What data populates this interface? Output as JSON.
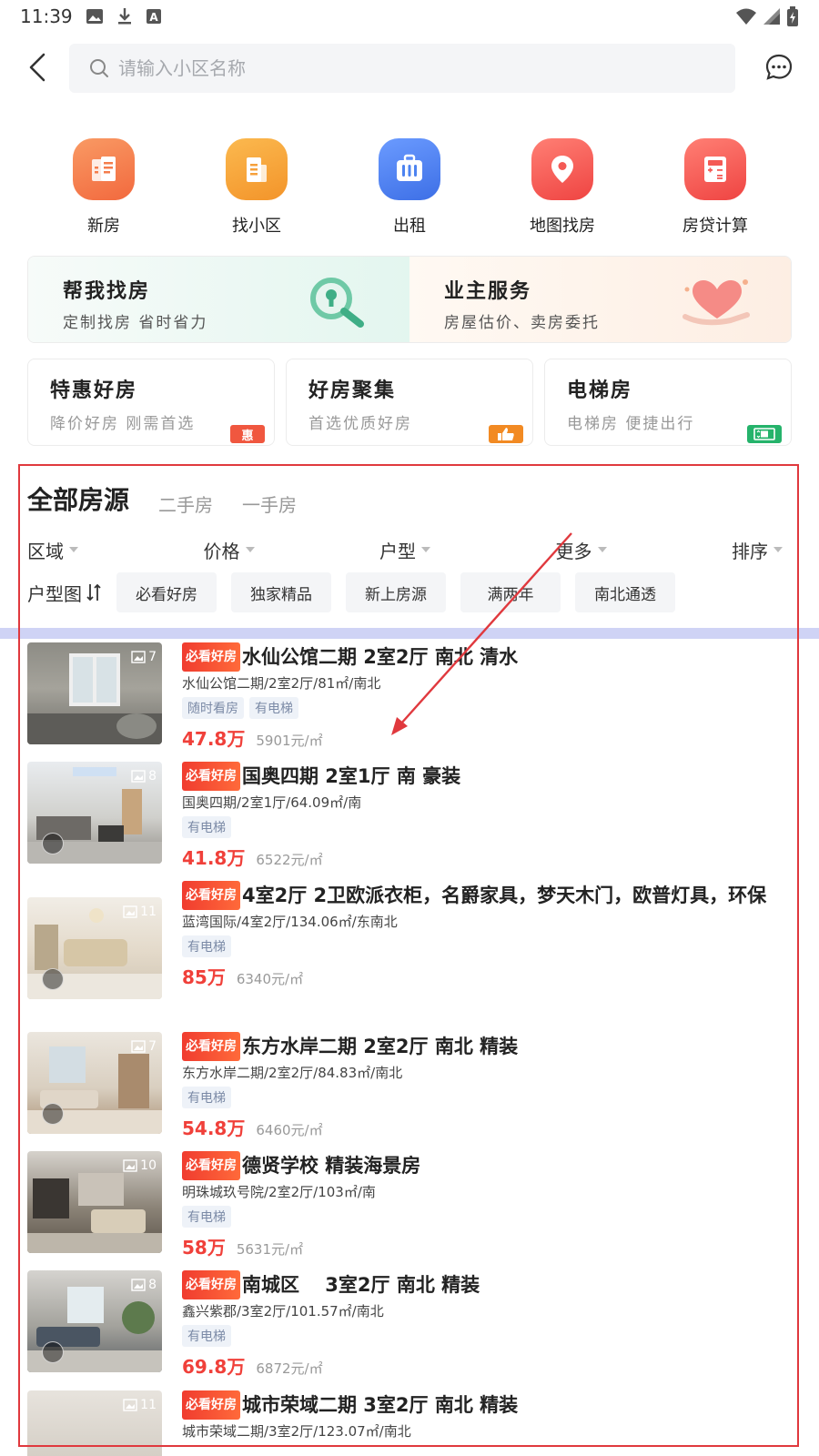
{
  "status_bar": {
    "time": "11:39"
  },
  "search": {
    "placeholder": "请输入小区名称"
  },
  "quick_nav": [
    {
      "label": "新房",
      "icon": "new-house-icon",
      "color": "#f47d4c"
    },
    {
      "label": "找小区",
      "icon": "community-icon",
      "color": "#f6a13c"
    },
    {
      "label": "出租",
      "icon": "rent-icon",
      "color": "#4d83f0"
    },
    {
      "label": "地图找房",
      "icon": "map-pin-icon",
      "color": "#f45a55"
    },
    {
      "label": "房贷计算",
      "icon": "calculator-icon",
      "color": "#f45a55"
    }
  ],
  "service_banner": {
    "left": {
      "title": "帮我找房",
      "subtitle": "定制找房 省时省力"
    },
    "right": {
      "title": "业主服务",
      "subtitle": "房屋估价、卖房委托"
    }
  },
  "feature_cards": [
    {
      "title": "特惠好房",
      "subtitle": "降价好房 刚需首选",
      "badge": "惠",
      "badge_color": "#f0573f"
    },
    {
      "title": "好房聚集",
      "subtitle": "首选优质好房",
      "badge": "",
      "badge_color": "#f28a23"
    },
    {
      "title": "电梯房",
      "subtitle": "电梯房 便捷出行",
      "badge": "",
      "badge_color": "#25b36b"
    }
  ],
  "tabs": [
    "全部房源",
    "二手房",
    "一手房"
  ],
  "filters": [
    "区域",
    "价格",
    "户型",
    "更多",
    "排序"
  ],
  "layout_toggle": "户型图",
  "chips": [
    "必看好房",
    "独家精品",
    "新上房源",
    "满两年",
    "南北通透"
  ],
  "badge_text": "必看好房",
  "listings": [
    {
      "title": "水仙公馆二期 2室2厅 南北 清水",
      "summary": "水仙公馆二期/2室2厅/81㎡/南北",
      "tags": [
        "随时看房",
        "有电梯"
      ],
      "price": "47.8万",
      "unit_price": "5901元/㎡",
      "photo_count": "7",
      "has_badge": true,
      "vr": false
    },
    {
      "title": "国奥四期 2室1厅 南 豪装",
      "summary": "国奥四期/2室1厅/64.09㎡/南",
      "tags": [
        "有电梯"
      ],
      "price": "41.8万",
      "unit_price": "6522元/㎡",
      "photo_count": "8",
      "has_badge": true,
      "vr": true
    },
    {
      "title": "4室2厅 2卫欧派衣柜，名爵家具，梦天木门，欧普灯具，环保",
      "summary": "蓝湾国际/4室2厅/134.06㎡/东南北",
      "tags": [
        "有电梯"
      ],
      "price": "85万",
      "unit_price": "6340元/㎡",
      "photo_count": "11",
      "has_badge": true,
      "vr": true
    },
    {
      "title": "东方水岸二期 2室2厅 南北 精装",
      "summary": "东方水岸二期/2室2厅/84.83㎡/南北",
      "tags": [
        "有电梯"
      ],
      "price": "54.8万",
      "unit_price": "6460元/㎡",
      "photo_count": "7",
      "has_badge": true,
      "vr": true
    },
    {
      "title": "德贤学校 精装海景房",
      "summary": "明珠城玖号院/2室2厅/103㎡/南",
      "tags": [
        "有电梯"
      ],
      "price": "58万",
      "unit_price": "5631元/㎡",
      "photo_count": "10",
      "has_badge": true,
      "vr": false
    },
    {
      "title": "南城区　 3室2厅 南北 精装",
      "summary": "鑫兴紫郡/3室2厅/101.57㎡/南北",
      "tags": [
        "有电梯"
      ],
      "price": "69.8万",
      "unit_price": "6872元/㎡",
      "photo_count": "8",
      "has_badge": true,
      "vr": true
    },
    {
      "title": "城市荣域二期 3室2厅 南北 精装",
      "summary": "城市荣域二期/3室2厅/123.07㎡/南北",
      "tags": [],
      "price": "",
      "unit_price": "",
      "photo_count": "11",
      "has_badge": true,
      "vr": false
    }
  ]
}
